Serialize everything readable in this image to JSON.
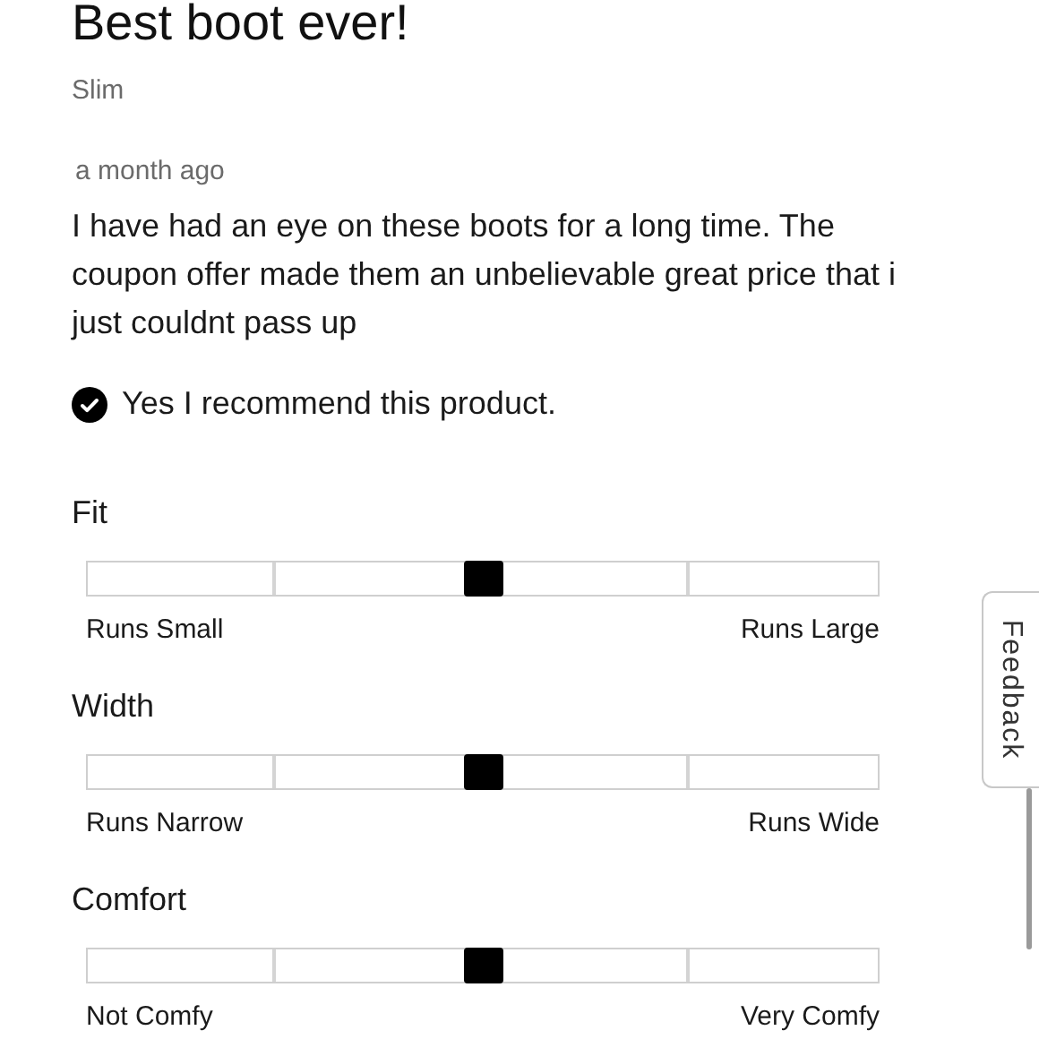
{
  "review": {
    "title": "Best boot ever!",
    "author": "Slim",
    "date": "a month ago",
    "body": "I have had an eye on these boots for a long time. The coupon offer made them an unbelievable great price that i just couldnt pass up",
    "recommend": {
      "checked": true,
      "label": "Yes I recommend this product."
    }
  },
  "ratings": [
    {
      "name": "Fit",
      "level": 0.5,
      "low": "Runs Small",
      "high": "Runs Large"
    },
    {
      "name": "Width",
      "level": 0.5,
      "low": "Runs Narrow",
      "high": "Runs Wide"
    },
    {
      "name": "Comfort",
      "level": 0.5,
      "low": "Not Comfy",
      "high": "Very Comfy"
    }
  ],
  "feedback_tab": {
    "label": "Feedback"
  }
}
